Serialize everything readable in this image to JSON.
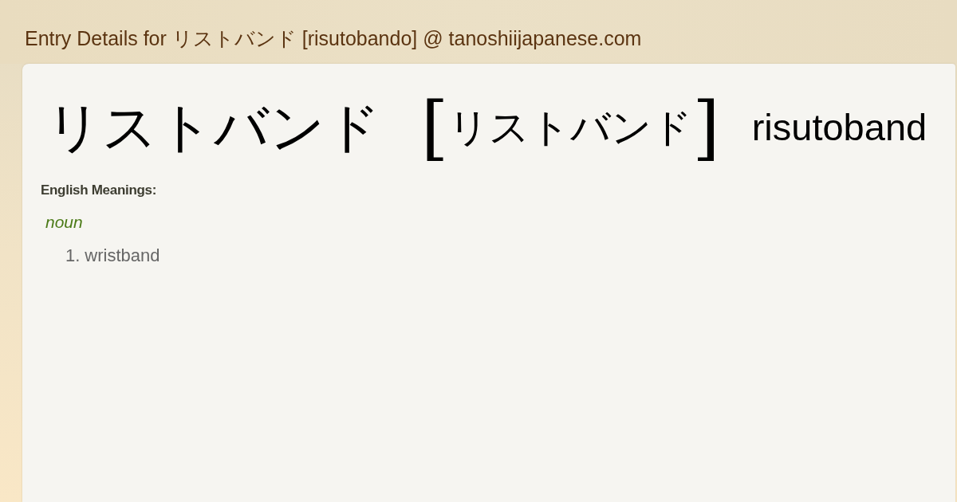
{
  "page": {
    "title": "Entry Details for リストバンド [risutobando] @ tanoshiijapanese.com"
  },
  "entry": {
    "headword": "リストバンド",
    "bracket_open": "[",
    "reading": "リストバンド",
    "bracket_close": "]",
    "romaji": "risutoband"
  },
  "meanings": {
    "label": "English Meanings:",
    "groups": [
      {
        "part_of_speech": "noun",
        "senses": [
          {
            "number": "1.",
            "text": "wristband"
          }
        ]
      }
    ]
  }
}
